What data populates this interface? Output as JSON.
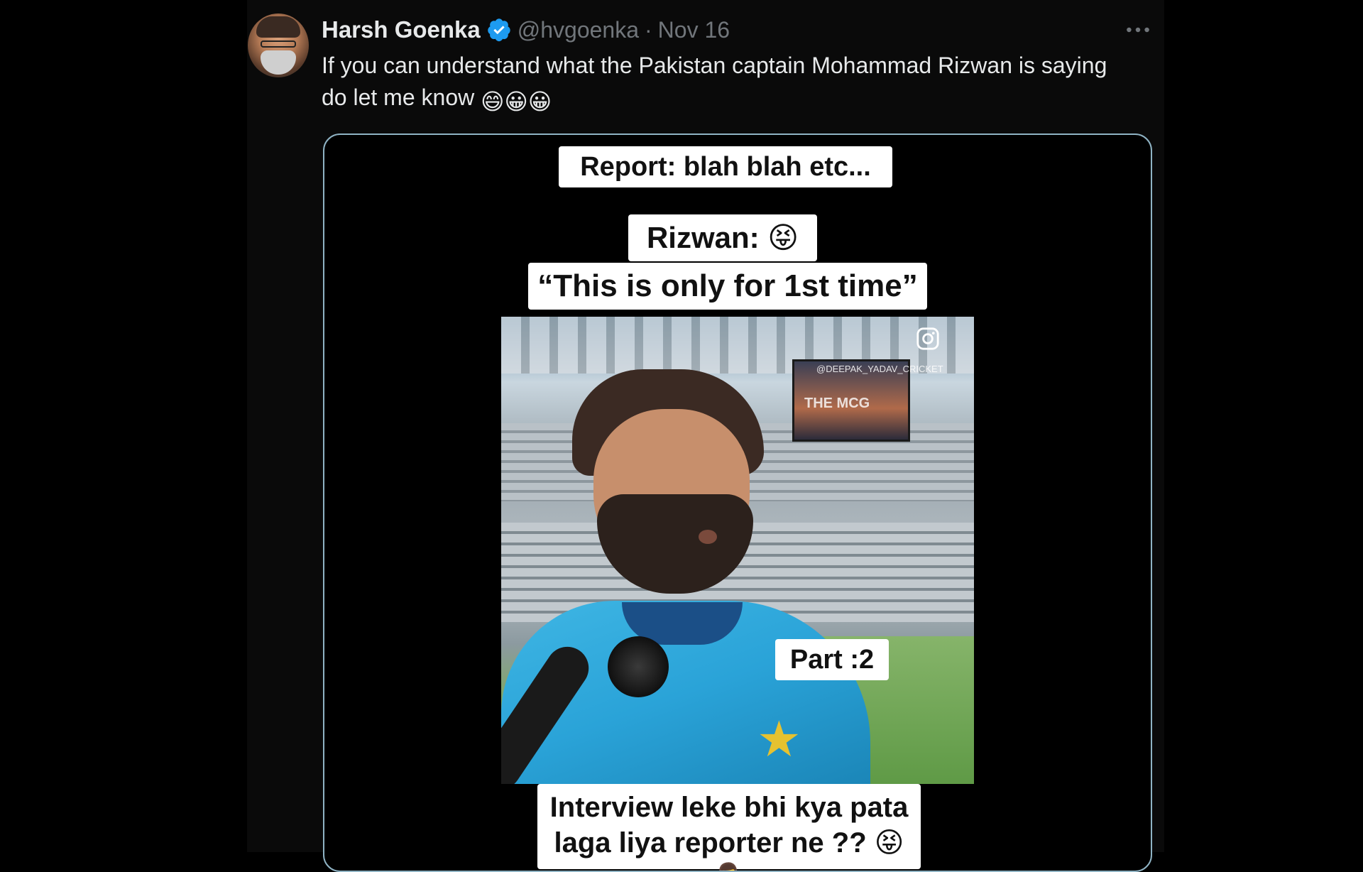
{
  "tweet": {
    "author_name": "Harsh Goenka",
    "handle": "@hvgoenka",
    "separator": "·",
    "date": "Nov 16",
    "text": "If you can understand what the Pakistan captain Mohammad Rizwan is saying do let me know",
    "emojis": [
      "😄",
      "😀",
      "😀"
    ]
  },
  "media": {
    "caption_report": "Report: blah blah etc...",
    "caption_rizwan": "Rizwan: 😝",
    "caption_quote": "“This is only for 1st time”",
    "watermark": "@DEEPAK_YADAV_CRICKET",
    "screen_text": "THE MCG",
    "part_label": "Part :2",
    "caption_bottom": "Interview leke bhi kya pata laga liya reporter ne ?? 😝🤷‍♂️"
  },
  "colors": {
    "background": "#000000",
    "column": "#0a0a0a",
    "text_primary": "#e7e9ea",
    "text_secondary": "#71767b",
    "verified_blue": "#1d9bf0"
  },
  "icons": {
    "verified": "verified-badge-icon",
    "more": "more-horizontal-icon",
    "instagram": "instagram-icon"
  }
}
